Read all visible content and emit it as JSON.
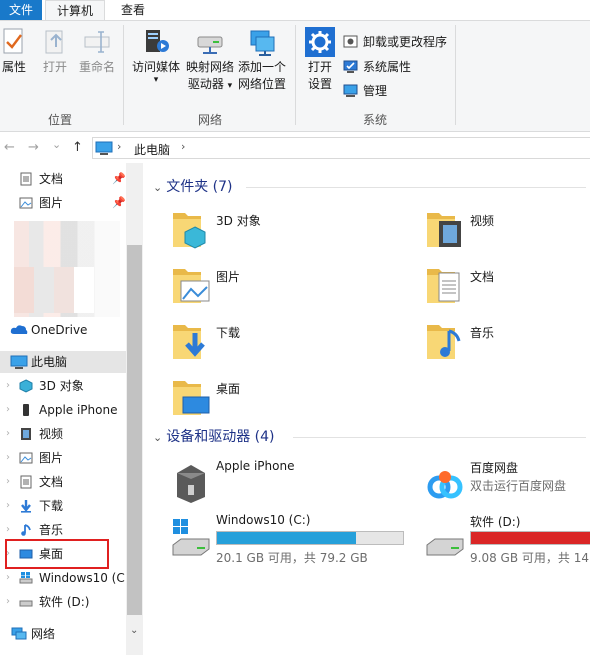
{
  "ribbon": {
    "tabs": [
      {
        "label": "文件"
      },
      {
        "label": "计算机"
      },
      {
        "label": "查看"
      }
    ],
    "groups": {
      "location": {
        "label": "位置",
        "buttons": [
          {
            "label": "属性",
            "icon": "properties-check-icon"
          },
          {
            "label": "打开",
            "icon": "open-icon"
          },
          {
            "label": "重命名",
            "icon": "rename-icon"
          }
        ]
      },
      "network": {
        "label": "网络",
        "buttons": [
          {
            "label": "访问媒体",
            "icon": "media-server-icon",
            "arrow": "▾"
          },
          {
            "label_line1": "映射网络",
            "label_line2": "驱动器",
            "icon": "map-drive-icon",
            "arrow": "▾"
          },
          {
            "label_line1": "添加一个",
            "label_line2": "网络位置",
            "icon": "network-location-icon"
          }
        ]
      },
      "system": {
        "label": "系统",
        "open_settings": {
          "label_line1": "打开",
          "label_line2": "设置",
          "icon": "settings-gear-icon"
        },
        "small_buttons": [
          {
            "label": "卸载或更改程序",
            "icon": "uninstall-icon"
          },
          {
            "label": "系统属性",
            "icon": "system-properties-icon"
          },
          {
            "label": "管理",
            "icon": "manage-icon"
          }
        ]
      }
    }
  },
  "address_bar": {
    "back": "←",
    "forward": "→",
    "recent": "⌄",
    "up": "↑",
    "separator": "›",
    "crumb": "此电脑"
  },
  "navigation": {
    "quick_access": [
      {
        "label": "文档",
        "icon": "documents-icon",
        "pinned": true
      },
      {
        "label": "图片",
        "icon": "pictures-icon",
        "pinned": true
      }
    ],
    "onedrive": {
      "label": "OneDrive",
      "icon": "onedrive-cloud-icon"
    },
    "this_pc": {
      "label": "此电脑",
      "icon": "this-pc-icon"
    },
    "pc_children": [
      {
        "label": "3D 对象",
        "icon": "3d-objects-icon"
      },
      {
        "label": "Apple iPhone",
        "icon": "iphone-icon"
      },
      {
        "label": "视频",
        "icon": "videos-icon"
      },
      {
        "label": "图片",
        "icon": "pictures-icon"
      },
      {
        "label": "文档",
        "icon": "documents-icon"
      },
      {
        "label": "下载",
        "icon": "downloads-icon"
      },
      {
        "label": "音乐",
        "icon": "music-icon"
      },
      {
        "label": "桌面",
        "icon": "desktop-icon"
      },
      {
        "label": "Windows10 (C:",
        "icon": "windows-drive-icon"
      },
      {
        "label": "软件 (D:)",
        "icon": "drive-icon"
      }
    ],
    "network": {
      "label": "网络",
      "icon": "network-icon"
    },
    "pin_glyph": "📌",
    "chevron": "›"
  },
  "content": {
    "folders_section": {
      "title": "文件夹 (7)"
    },
    "folders": [
      {
        "label": "3D 对象",
        "icon": "3d-objects-folder-icon"
      },
      {
        "label": "视频",
        "icon": "videos-folder-icon"
      },
      {
        "label": "图片",
        "icon": "pictures-folder-icon"
      },
      {
        "label": "文档",
        "icon": "documents-folder-icon"
      },
      {
        "label": "下载",
        "icon": "downloads-folder-icon"
      },
      {
        "label": "音乐",
        "icon": "music-folder-icon"
      },
      {
        "label": "桌面",
        "icon": "desktop-folder-icon"
      }
    ],
    "devices_section": {
      "title": "设备和驱动器 (4)"
    },
    "devices": [
      {
        "label": "Apple iPhone",
        "icon": "iphone-device-icon"
      },
      {
        "label": "百度网盘",
        "sub": "双击运行百度网盘",
        "icon": "baidu-netdisk-icon"
      },
      {
        "label": "Windows10 (C:)",
        "stat": "20.1 GB 可用，共 79.2 GB",
        "used_fraction": 0.746,
        "bar_color": "#26a0da",
        "icon": "windows-drive-icon"
      },
      {
        "label": "软件 (D:)",
        "stat": "9.08 GB 可用，共 14...",
        "used_fraction": 0.94,
        "bar_color": "#da2626",
        "icon": "hard-drive-icon"
      }
    ]
  },
  "colors": {
    "accent": "#1979ca",
    "section_title": "#1e3287",
    "drive_ok": "#26a0da",
    "drive_full": "#da2626",
    "highlight_box": "#e02020"
  }
}
